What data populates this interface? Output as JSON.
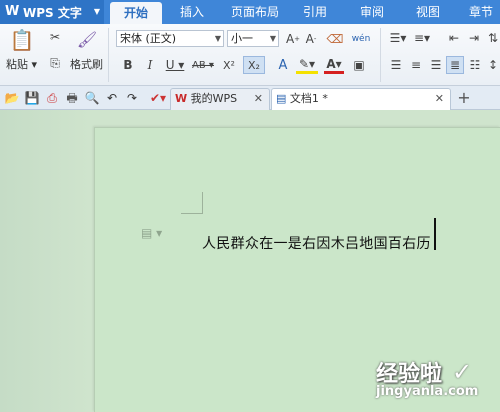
{
  "app": {
    "title": "WPS 文字"
  },
  "ribbon_tabs": [
    "开始",
    "插入",
    "页面布局",
    "引用",
    "审阅",
    "视图",
    "章节"
  ],
  "clipboard": {
    "paste": "粘贴",
    "format_painter": "格式刷"
  },
  "font": {
    "name": "宋体 (正文)",
    "size": "小一"
  },
  "doc_tabs": [
    {
      "label": "我的WPS"
    },
    {
      "label": "文档1 *"
    }
  ],
  "document": {
    "text": "人民群众在一是右因木吕地国百右历"
  },
  "watermark": {
    "brand": "经验啦",
    "url": "jingyanla.com"
  },
  "colors": {
    "accent": "#3f86d8",
    "page": "#cbe6c9"
  }
}
